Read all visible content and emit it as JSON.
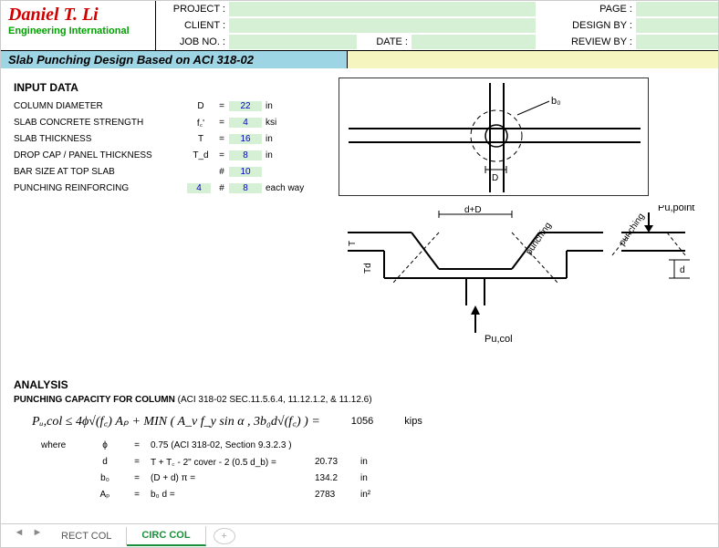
{
  "logo": {
    "name": "Daniel T. Li",
    "sub": "Engineering International"
  },
  "header": {
    "project_label": "PROJECT :",
    "client_label": "CLIENT :",
    "jobno_label": "JOB NO. :",
    "date_label": "DATE :",
    "page_label": "PAGE :",
    "designby_label": "DESIGN BY :",
    "reviewby_label": "REVIEW BY :"
  },
  "title": "Slab Punching Design Based on ACI 318-02",
  "input": {
    "heading": "INPUT DATA",
    "rows": [
      {
        "label": "COLUMN DIAMETER",
        "sym": "D",
        "eq": "=",
        "val": "22",
        "unit": "in"
      },
      {
        "label": "SLAB CONCRETE STRENGTH",
        "sym": "f꜀'",
        "eq": "=",
        "val": "4",
        "unit": "ksi"
      },
      {
        "label": "SLAB THICKNESS",
        "sym": "T",
        "eq": "=",
        "val": "16",
        "unit": "in"
      },
      {
        "label": "DROP CAP / PANEL THICKNESS",
        "sym": "T_d",
        "eq": "=",
        "val": "8",
        "unit": "in"
      },
      {
        "label": "BAR SIZE AT TOP SLAB",
        "sym": "",
        "eq": "#",
        "val": "10",
        "unit": ""
      },
      {
        "label": "PUNCHING REINFORCING",
        "sym": "",
        "pre": "4",
        "eq": "#",
        "val": "8",
        "unit": "each way"
      }
    ]
  },
  "diagram": {
    "top": {
      "b0": "b₀",
      "D": "D"
    },
    "bot": {
      "dD": "d+D",
      "T": "T",
      "Td": "Td",
      "punching": "punching",
      "d": "d",
      "Pu_col": "Pu,col",
      "Pu_point": "Pu,point"
    }
  },
  "analysis": {
    "heading": "ANALYSIS",
    "sub_bold": "PUNCHING CAPACITY FOR COLUMN",
    "sub_ref": " (ACI 318-02 SEC.11.5.6.4, 11.12.1.2, & 11.12.6)",
    "formula_lhs": "Pᵤ,col ≤ 4ϕ√(f꜀) Aₚ + MIN ( A_v f_y sin α  ,   3b₀d√(f꜀) ) =",
    "formula_val": "1056",
    "formula_unit": "kips",
    "where": "where",
    "rows": [
      {
        "sym": "ϕ",
        "eq": "=",
        "expr": "0.75   (ACI 318-02, Section 9.3.2.3 )",
        "val": "",
        "unit": ""
      },
      {
        "sym": "d",
        "eq": "=",
        "expr": "T + T꜀ - 2\" cover - 2 (0.5 d_b) =",
        "val": "20.73",
        "unit": "in"
      },
      {
        "sym": "b₀",
        "eq": "=",
        "expr": "(D + d) π =",
        "val": "134.2",
        "unit": "in"
      },
      {
        "sym": "Aₚ",
        "eq": "=",
        "expr": "b₀ d      =",
        "val": "2783",
        "unit": "in²"
      }
    ]
  },
  "tabs": {
    "rect": "RECT COL",
    "circ": "CIRC COL"
  }
}
